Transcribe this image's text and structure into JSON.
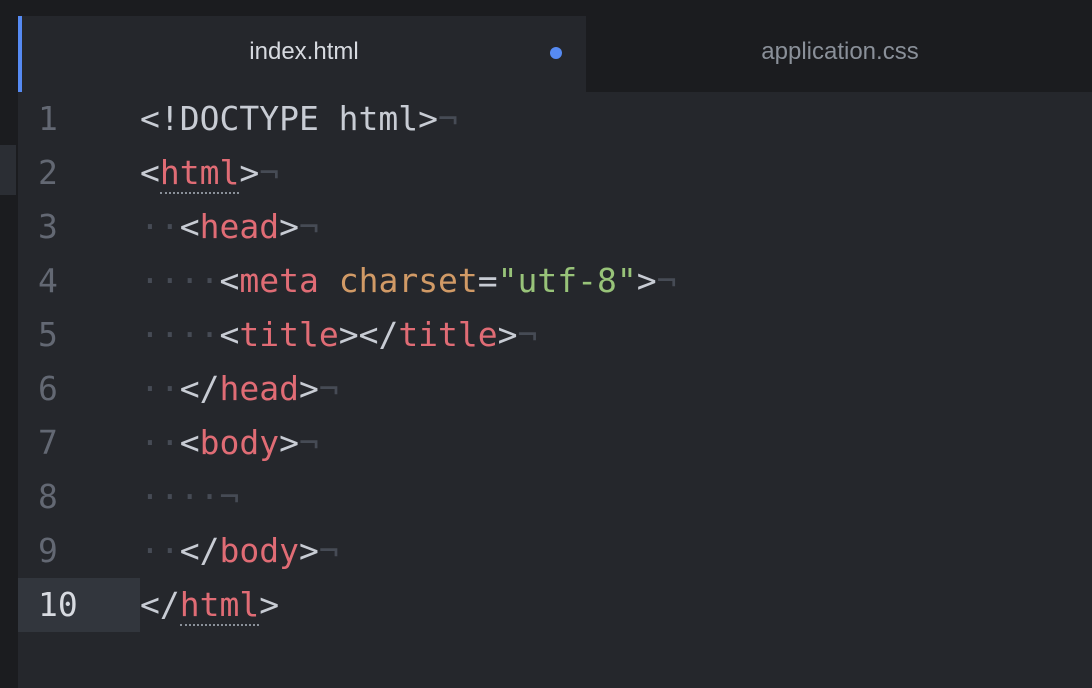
{
  "tabs": [
    {
      "label": "index.html",
      "active": true,
      "modified": true
    },
    {
      "label": "application.css",
      "active": false,
      "modified": false
    }
  ],
  "editor": {
    "cursor_line": 10,
    "invisibles": {
      "space": "·",
      "eol": "¬"
    },
    "lines": [
      {
        "number": "1",
        "indent": "",
        "tokens": [
          {
            "t": "punct",
            "v": "<!DOCTYPE html>"
          }
        ]
      },
      {
        "number": "2",
        "indent": "",
        "tokens": [
          {
            "t": "punct",
            "v": "<"
          },
          {
            "t": "tag",
            "v": "html",
            "match": true
          },
          {
            "t": "punct",
            "v": ">"
          }
        ]
      },
      {
        "number": "3",
        "indent": "··",
        "tokens": [
          {
            "t": "punct",
            "v": "<"
          },
          {
            "t": "tag",
            "v": "head"
          },
          {
            "t": "punct",
            "v": ">"
          }
        ]
      },
      {
        "number": "4",
        "indent": "····",
        "tokens": [
          {
            "t": "punct",
            "v": "<"
          },
          {
            "t": "tag",
            "v": "meta"
          },
          {
            "t": "punct",
            "v": " "
          },
          {
            "t": "attr",
            "v": "charset"
          },
          {
            "t": "punct",
            "v": "="
          },
          {
            "t": "str",
            "v": "\"utf-8\""
          },
          {
            "t": "punct",
            "v": ">"
          }
        ]
      },
      {
        "number": "5",
        "indent": "····",
        "tokens": [
          {
            "t": "punct",
            "v": "<"
          },
          {
            "t": "tag",
            "v": "title"
          },
          {
            "t": "punct",
            "v": "></"
          },
          {
            "t": "tag",
            "v": "title"
          },
          {
            "t": "punct",
            "v": ">"
          }
        ]
      },
      {
        "number": "6",
        "indent": "··",
        "tokens": [
          {
            "t": "punct",
            "v": "</"
          },
          {
            "t": "tag",
            "v": "head"
          },
          {
            "t": "punct",
            "v": ">"
          }
        ]
      },
      {
        "number": "7",
        "indent": "··",
        "tokens": [
          {
            "t": "punct",
            "v": "<"
          },
          {
            "t": "tag",
            "v": "body"
          },
          {
            "t": "punct",
            "v": ">"
          }
        ]
      },
      {
        "number": "8",
        "indent": "····",
        "tokens": []
      },
      {
        "number": "9",
        "indent": "··",
        "tokens": [
          {
            "t": "punct",
            "v": "</"
          },
          {
            "t": "tag",
            "v": "body"
          },
          {
            "t": "punct",
            "v": ">"
          }
        ]
      },
      {
        "number": "10",
        "indent": "",
        "eol": false,
        "tokens": [
          {
            "t": "punct",
            "v": "</"
          },
          {
            "t": "tag",
            "v": "html",
            "match": true
          },
          {
            "t": "punct",
            "v": ">"
          }
        ]
      }
    ]
  },
  "colors": {
    "background": "#25272c",
    "tab_bar": "#1b1c1f",
    "accent": "#568af2",
    "tag": "#e06c75",
    "attribute": "#d19a66",
    "string": "#98c379",
    "text": "#c8ccd4",
    "invisible": "#464b55",
    "line_number": "#636873"
  }
}
